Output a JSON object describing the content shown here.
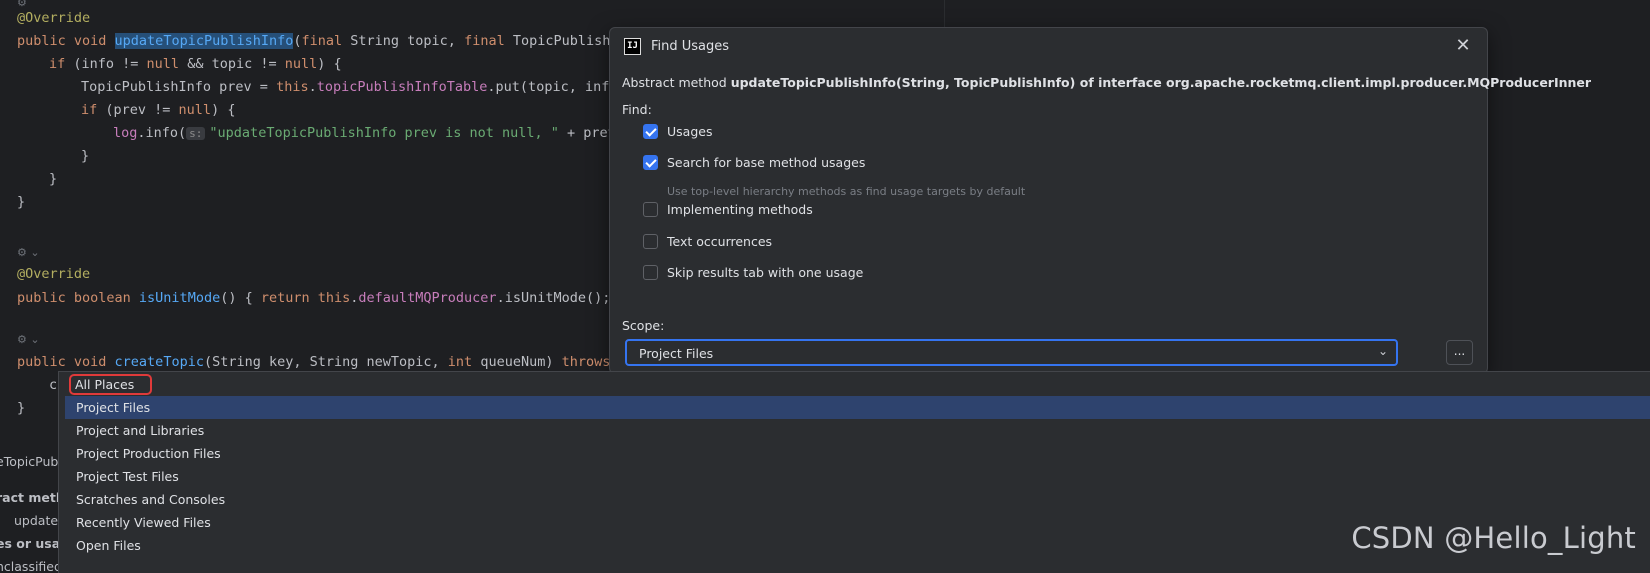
{
  "editor": {
    "lines": {
      "l1": "@Override",
      "l2_a": "public void ",
      "l2_fn": "updateTopicPublishInfo",
      "l2_b": "(",
      "l2_kw1": "final",
      "l2_c": " String topic, ",
      "l2_kw2": "final",
      "l2_d": " TopicPublishI",
      "l3_a": "if",
      "l3_b": " (info != ",
      "l3_kw": "null",
      "l3_c": " && topic != ",
      "l3_kw2": "null",
      "l3_d": ") {",
      "l4_a": "TopicPublishInfo prev = ",
      "l4_kw": "this",
      "l4_b": ".",
      "l4_fld": "topicPublishInfoTable",
      "l4_c": ".put(topic, info",
      "l5_kw": "if",
      "l5_a": " (prev != ",
      "l5_kw2": "null",
      "l5_b": ") {",
      "l6_fld": "log",
      "l6_a": ".info(",
      "l6_hint": "s:",
      "l6_str": "\"updateTopicPublishInfo prev is not null, \"",
      "l6_b": " + prev",
      "l7": "}",
      "l8": "}",
      "l9": "}",
      "l10": "@Override",
      "l11_a": "public boolean ",
      "l11_fn": "isUnitMode",
      "l11_b": "() { ",
      "l11_kw": "return this",
      "l11_c": ".",
      "l11_fld": "defaultMQProducer",
      "l11_d": ".isUnitMode();",
      "l12_a": "public void ",
      "l12_fn": "createTopic",
      "l12_b": "(String key, String newTopic, ",
      "l12_kw": "int",
      "l12_c": " queueNum) ",
      "l12_kw2": "throws",
      "l13": "c",
      "l14": "}"
    }
  },
  "peek": {
    "tab": "eTopicPublis",
    "desc": "ract metho",
    "item": "update",
    "group": "es or usag",
    "unclassified": "nclassified"
  },
  "dialog": {
    "title": "Find Usages",
    "app_icon": "IJ",
    "close": "✕",
    "desc_prefix": "Abstract method ",
    "desc_method": "updateTopicPublishInfo(String, TopicPublishInfo)",
    "desc_middle": " of interface ",
    "desc_iface": "org.apache.rocketmq.client.impl.producer.MQProducerInner",
    "find_label": "Find:",
    "options": [
      {
        "label": "Usages",
        "checked": true
      },
      {
        "label": "Search for base method usages",
        "checked": true
      },
      {
        "label": "Implementing methods",
        "checked": false
      },
      {
        "label": "Text occurrences",
        "checked": false
      },
      {
        "label": "Skip results tab with one usage",
        "checked": false
      }
    ],
    "base_hint": "Use top-level hierarchy methods as find usage targets by default",
    "scope_label": "Scope:",
    "scope_value": "Project Files",
    "more_label": "..."
  },
  "dropdown": {
    "items": [
      "All Places",
      "Project Files",
      "Project and Libraries",
      "Project Production Files",
      "Project Test Files",
      "Scratches and Consoles",
      "Recently Viewed Files",
      "Open Files"
    ],
    "selected_index": 1,
    "highlighted_index": 0
  },
  "watermark": "CSDN @Hello_Light",
  "colors": {
    "accent": "#3574f0",
    "selection": "#2e436e",
    "highlight_ring": "#e03a3a"
  }
}
